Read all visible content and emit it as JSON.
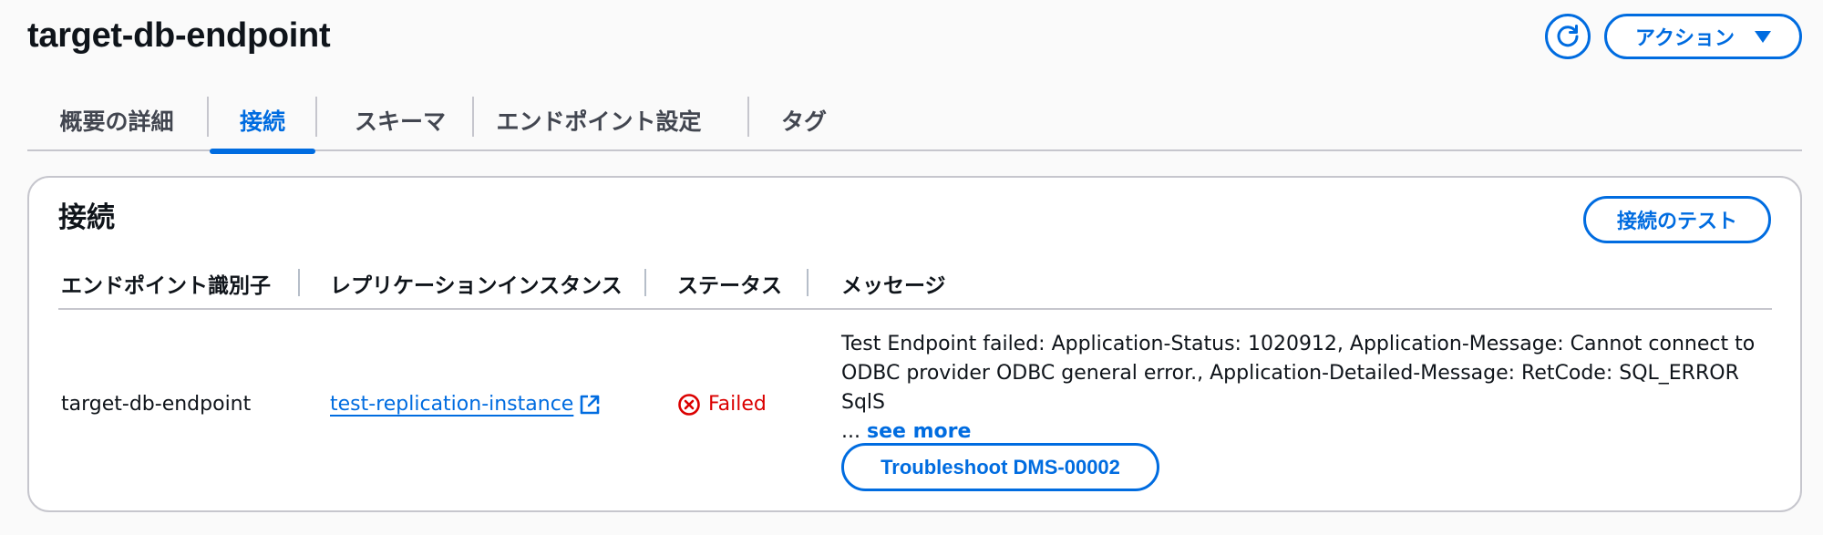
{
  "header": {
    "title": "target-db-endpoint",
    "actions_label": "アクション"
  },
  "tabs": [
    {
      "label": "概要の詳細",
      "active": false
    },
    {
      "label": "接続",
      "active": true
    },
    {
      "label": "スキーマ",
      "active": false
    },
    {
      "label": "エンドポイント設定",
      "active": false
    },
    {
      "label": "タグ",
      "active": false
    }
  ],
  "connection": {
    "title": "接続",
    "test_button": "接続のテスト",
    "columns": [
      "エンドポイント識別子",
      "レプリケーションインスタンス",
      "ステータス",
      "メッセージ"
    ],
    "row": {
      "endpoint_id": "target-db-endpoint",
      "replication_instance": "test-replication-instance",
      "status": "Failed",
      "message_line1": "Test Endpoint failed: Application-Status: 1020912, Application-Message: Cannot connect to",
      "message_line2": "ODBC provider ODBC general error., Application-Detailed-Message: RetCode: SQL_ERROR SqlS",
      "message_ellipsis": "...",
      "see_more": "see more",
      "troubleshoot_button": "Troubleshoot DMS-00002"
    }
  },
  "colors": {
    "accent": "#006ce0",
    "error": "#db0000",
    "border": "#c6c6cd"
  },
  "icons": {
    "refresh": "refresh-icon",
    "caret": "caret-down-icon",
    "external_link": "external-link-icon",
    "status": "error-circle-icon"
  }
}
